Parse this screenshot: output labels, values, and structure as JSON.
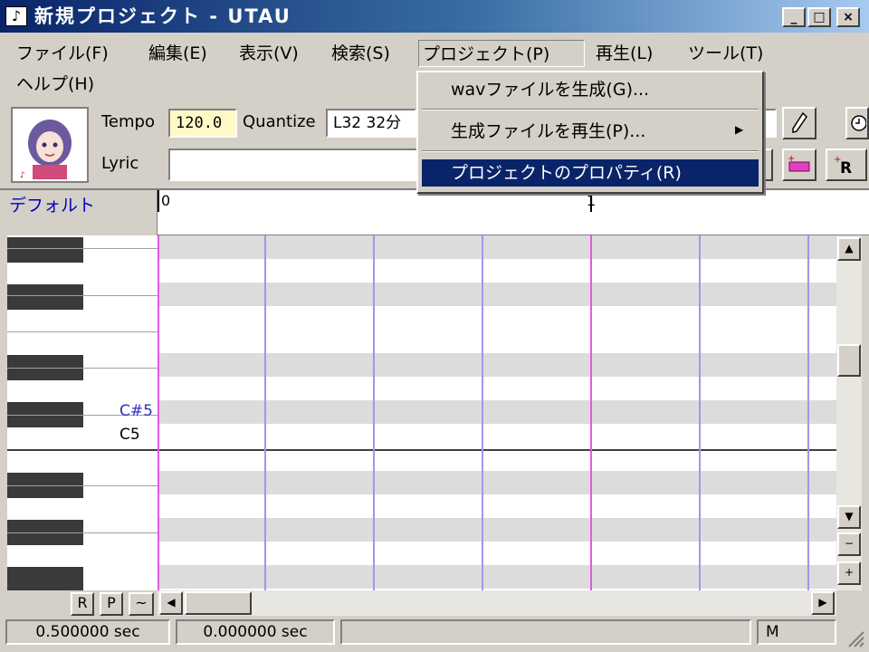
{
  "window": {
    "title": "新規プロジェクト - UTAU",
    "minimize": "_",
    "maximize": "□",
    "close": "×"
  },
  "menu": {
    "file": "ファイル(F)",
    "edit": "編集(E)",
    "view": "表示(V)",
    "search": "検索(S)",
    "project": "プロジェクト(P)",
    "play": "再生(L)",
    "tools": "ツール(T)",
    "help": "ヘルプ(H)"
  },
  "project_menu": {
    "items": [
      "wavファイルを生成(G)...",
      "生成ファイルを再生(P)...",
      "プロジェクトのプロパティ(R)"
    ],
    "selected_index": 2,
    "submenu_arrow": "▶"
  },
  "toolbar": {
    "tempo_label": "Tempo",
    "tempo_value": "120.0",
    "quantize_label": "Quantize",
    "quantize_value": "L32 32分",
    "lyric_label": "Lyric",
    "lyric_value": ""
  },
  "track": {
    "name": "デフォルト",
    "ruler_marks": [
      "0",
      "1"
    ]
  },
  "piano": {
    "labels": [
      "C#5",
      "C5"
    ]
  },
  "bottom_tabs": [
    "R",
    "P",
    "~"
  ],
  "status": {
    "length": "0.500000 sec",
    "position": "0.000000 sec",
    "mode": "M"
  },
  "colors": {
    "title_start": "#0a246a",
    "title_end": "#a6caf0",
    "menu_highlight": "#0a246a",
    "grid_row_dark": "#dcdcdc",
    "grid_row_light": "#ffffff",
    "grid_beat_line": "#9a9ae8",
    "grid_bar_line": "#e05ce0",
    "tempo_bg": "#fff9c8",
    "track_name": "#0000c0"
  },
  "icons": {
    "app": "music-note-icon",
    "pencil": "pencil-icon",
    "submenu": "arrow-right-icon"
  }
}
